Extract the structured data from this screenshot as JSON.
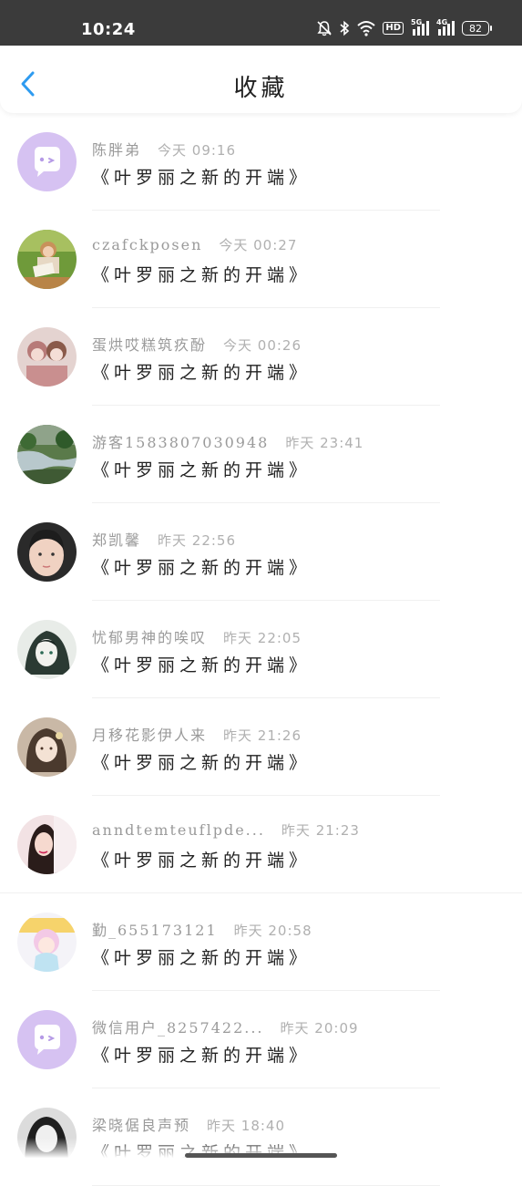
{
  "status_bar": {
    "time": "10:24",
    "network_1": "5G",
    "network_2": "4G",
    "hd": "HD",
    "battery": "82"
  },
  "header": {
    "title": "收藏",
    "back_icon": "chevron-left-icon",
    "accent_color": "#2e9bf0"
  },
  "favorites": [
    {
      "user": "陈胖弟",
      "time": "今天 09:16",
      "content": "《叶罗丽之新的开端》",
      "avatar": "default-chat-avatar"
    },
    {
      "user": "czafckposen",
      "time": "今天 00:27",
      "content": "《叶罗丽之新的开端》",
      "avatar": "photo-avatar"
    },
    {
      "user": "蛋烘哎糕筑疚酚",
      "time": "今天 00:26",
      "content": "《叶罗丽之新的开端》",
      "avatar": "photo-avatar"
    },
    {
      "user": "游客1583807030948",
      "time": "昨天 23:41",
      "content": "《叶罗丽之新的开端》",
      "avatar": "photo-avatar"
    },
    {
      "user": "郑凯馨",
      "time": "昨天 22:56",
      "content": "《叶罗丽之新的开端》",
      "avatar": "photo-avatar"
    },
    {
      "user": "忧郁男神的唉叹",
      "time": "昨天 22:05",
      "content": "《叶罗丽之新的开端》",
      "avatar": "photo-avatar"
    },
    {
      "user": "月移花影伊人来",
      "time": "昨天 21:26",
      "content": "《叶罗丽之新的开端》",
      "avatar": "photo-avatar"
    },
    {
      "user": "anndtemteuflpde...",
      "time": "昨天 21:23",
      "content": "《叶罗丽之新的开端》",
      "avatar": "photo-avatar"
    },
    {
      "user": "勤_655173121",
      "time": "昨天 20:58",
      "content": "《叶罗丽之新的开端》",
      "avatar": "photo-avatar"
    },
    {
      "user": "微信用户_8257422...",
      "time": "昨天 20:09",
      "content": "《叶罗丽之新的开端》",
      "avatar": "default-chat-avatar"
    },
    {
      "user": "梁晓倨良声预",
      "time": "昨天 18:40",
      "content": "《叶罗丽之新的开端》",
      "avatar": "photo-avatar"
    }
  ]
}
